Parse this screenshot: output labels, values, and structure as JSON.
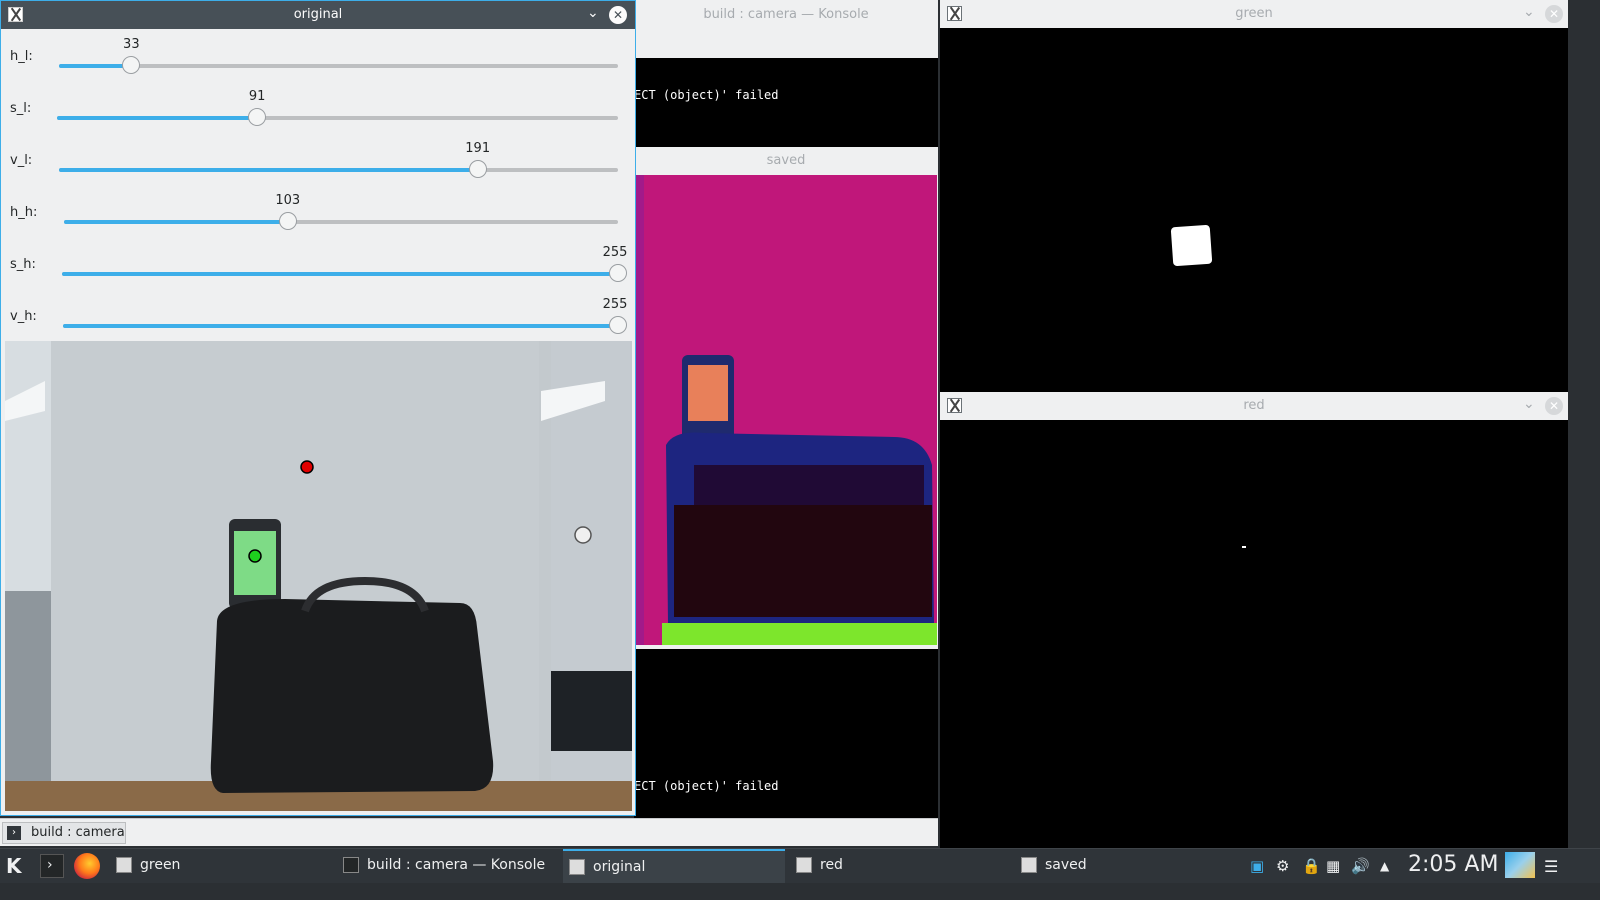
{
  "windows": {
    "konsole": {
      "title": "build : camera — Konsole",
      "line1": "ECT (object)' failed",
      "line2": "ECT (object)' failed",
      "tab_label": "build : camera"
    },
    "saved": {
      "title": "saved"
    },
    "green": {
      "title": "green"
    },
    "red": {
      "title": "red"
    },
    "original": {
      "title": "original",
      "trackbars": [
        {
          "label": "h_l:",
          "value": 33,
          "max": 255
        },
        {
          "label": "s_l:",
          "value": 91,
          "max": 255
        },
        {
          "label": "v_l:",
          "value": 191,
          "max": 255
        },
        {
          "label": "h_h:",
          "value": 103,
          "max": 255
        },
        {
          "label": "s_h:",
          "value": 255,
          "max": 255
        },
        {
          "label": "v_h:",
          "value": 255,
          "max": 255
        }
      ]
    }
  },
  "taskbar": {
    "tasks": [
      {
        "label": "green",
        "icon": "x-window-icon"
      },
      {
        "label": "build : camera — Konsole",
        "icon": "terminal-icon"
      },
      {
        "label": "original",
        "icon": "x-window-icon",
        "active": true
      },
      {
        "label": "red",
        "icon": "x-window-icon"
      },
      {
        "label": "saved",
        "icon": "x-window-icon"
      }
    ],
    "clock": "2:05 AM"
  },
  "colors": {
    "accent": "#3daee9",
    "titlebar_active": "#475057",
    "saved_background": "#c0177a",
    "mask_white": "#ffffff"
  }
}
